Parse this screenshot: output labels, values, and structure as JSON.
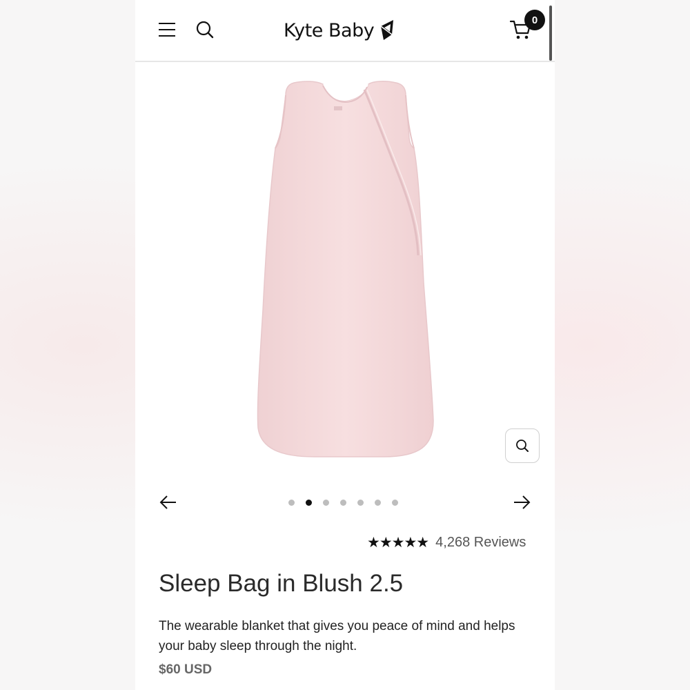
{
  "header": {
    "brand": "Kyte Baby",
    "cart_count": "0"
  },
  "carousel": {
    "total_slides": 7,
    "active_slide": 2
  },
  "reviews": {
    "stars": "★★★★★",
    "rating": 5,
    "count_label": "4,268 Reviews"
  },
  "product": {
    "title": "Sleep Bag in Blush 2.5",
    "description": "The wearable blanket that gives you peace of mind and helps your baby sleep through the night.",
    "price": "$60 USD",
    "color": "#f4d9da"
  },
  "icons": {
    "menu": "hamburger-menu-icon",
    "search": "search-icon",
    "cart": "shopping-cart-icon",
    "zoom": "magnifier-icon",
    "prev": "arrow-left-icon",
    "next": "arrow-right-icon",
    "logo": "kite-icon"
  }
}
